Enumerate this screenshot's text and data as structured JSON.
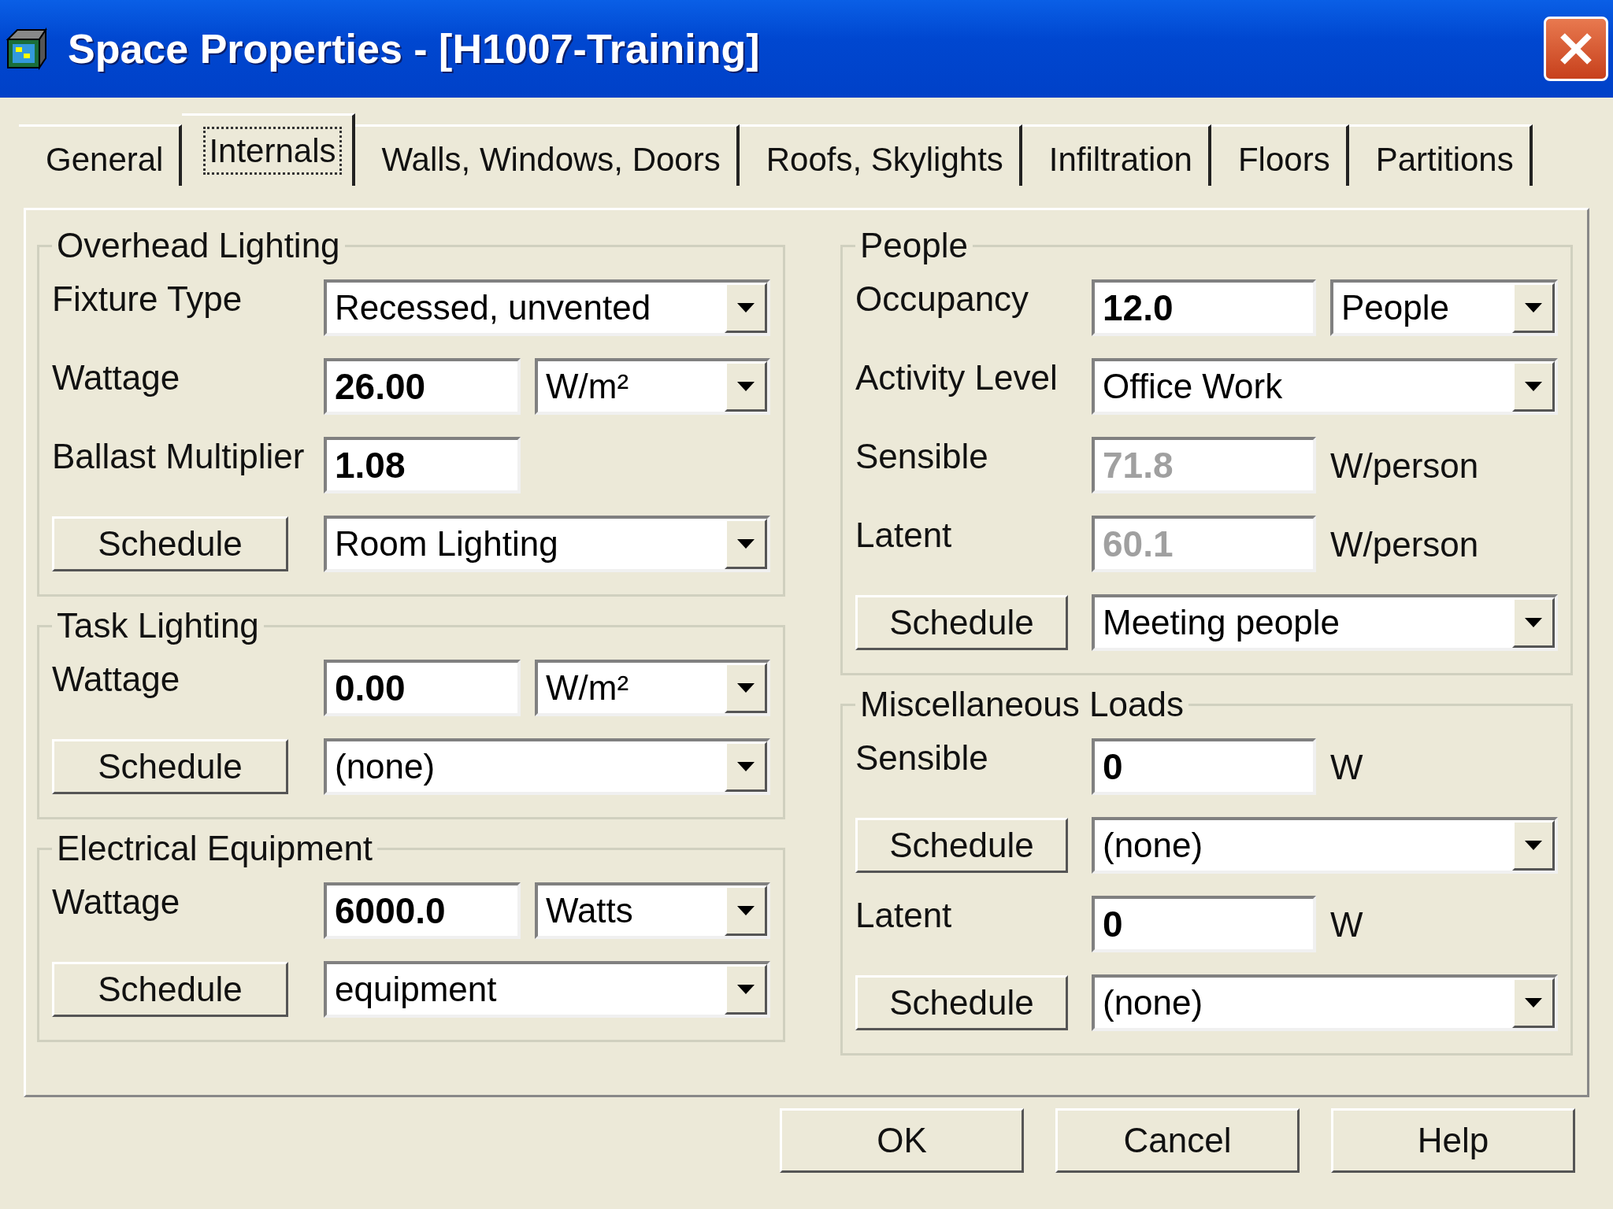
{
  "window": {
    "title": "Space Properties - [H1007-Training]"
  },
  "tabs": [
    {
      "label": "General",
      "selected": false
    },
    {
      "label": "Internals",
      "selected": true
    },
    {
      "label": "Walls, Windows, Doors",
      "selected": false
    },
    {
      "label": "Roofs, Skylights",
      "selected": false
    },
    {
      "label": "Infiltration",
      "selected": false
    },
    {
      "label": "Floors",
      "selected": false
    },
    {
      "label": "Partitions",
      "selected": false
    }
  ],
  "columns": [
    [
      {
        "title": "Overhead Lighting",
        "rows": [
          {
            "kind": "label",
            "label": "Fixture Type",
            "controls": [
              {
                "kind": "combo",
                "value": "Recessed, unvented"
              }
            ]
          },
          {
            "kind": "label",
            "label": "Wattage",
            "controls": [
              {
                "kind": "input",
                "value": "26.00",
                "disabled": false
              },
              {
                "kind": "combo",
                "value": "W/m²"
              }
            ]
          },
          {
            "kind": "label",
            "label": "Ballast Multiplier",
            "controls": [
              {
                "kind": "input",
                "value": "1.08",
                "disabled": false
              }
            ]
          },
          {
            "kind": "button",
            "label": "Schedule",
            "controls": [
              {
                "kind": "combo",
                "value": "Room Lighting"
              }
            ]
          }
        ]
      },
      {
        "title": "Task Lighting",
        "rows": [
          {
            "kind": "label",
            "label": "Wattage",
            "controls": [
              {
                "kind": "input",
                "value": "0.00",
                "disabled": false
              },
              {
                "kind": "combo",
                "value": "W/m²"
              }
            ]
          },
          {
            "kind": "button",
            "label": "Schedule",
            "controls": [
              {
                "kind": "combo",
                "value": "(none)"
              }
            ]
          }
        ]
      },
      {
        "title": "Electrical Equipment",
        "rows": [
          {
            "kind": "label",
            "label": "Wattage",
            "controls": [
              {
                "kind": "input",
                "value": "6000.0",
                "disabled": false
              },
              {
                "kind": "combo",
                "value": "Watts"
              }
            ]
          },
          {
            "kind": "button",
            "label": "Schedule",
            "controls": [
              {
                "kind": "combo",
                "value": "equipment"
              }
            ]
          }
        ]
      }
    ],
    [
      {
        "title": "People",
        "rows": [
          {
            "kind": "label",
            "label": "Occupancy",
            "controls": [
              {
                "kind": "input",
                "value": "12.0",
                "disabled": false
              },
              {
                "kind": "combo",
                "value": "People"
              }
            ]
          },
          {
            "kind": "label",
            "label": "Activity Level",
            "controls": [
              {
                "kind": "combo",
                "value": "Office Work"
              }
            ]
          },
          {
            "kind": "label",
            "label": "Sensible",
            "controls": [
              {
                "kind": "input",
                "value": "71.8",
                "disabled": true
              },
              {
                "kind": "unit",
                "value": "W/person"
              }
            ]
          },
          {
            "kind": "label",
            "label": "Latent",
            "controls": [
              {
                "kind": "input",
                "value": "60.1",
                "disabled": true
              },
              {
                "kind": "unit",
                "value": "W/person"
              }
            ]
          },
          {
            "kind": "button",
            "label": "Schedule",
            "controls": [
              {
                "kind": "combo",
                "value": "Meeting people"
              }
            ]
          }
        ]
      },
      {
        "title": "Miscellaneous Loads",
        "rows": [
          {
            "kind": "label",
            "label": "Sensible",
            "controls": [
              {
                "kind": "input",
                "value": "0",
                "disabled": false
              },
              {
                "kind": "unit",
                "value": "W"
              }
            ]
          },
          {
            "kind": "button",
            "label": "Schedule",
            "controls": [
              {
                "kind": "combo",
                "value": "(none)"
              }
            ]
          },
          {
            "kind": "label",
            "label": "Latent",
            "controls": [
              {
                "kind": "input",
                "value": "0",
                "disabled": false
              },
              {
                "kind": "unit",
                "value": "W"
              }
            ]
          },
          {
            "kind": "button",
            "label": "Schedule",
            "controls": [
              {
                "kind": "combo",
                "value": "(none)"
              }
            ]
          }
        ]
      }
    ]
  ],
  "buttons": [
    "OK",
    "Cancel",
    "Help"
  ]
}
